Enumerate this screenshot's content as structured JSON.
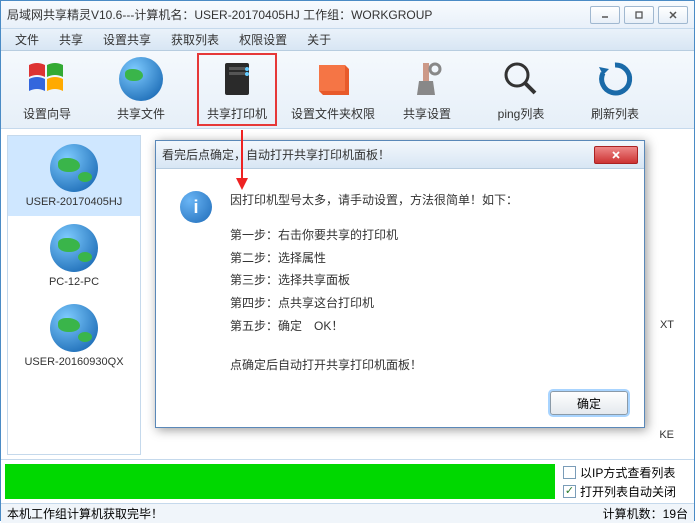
{
  "title": "局域网共享精灵V10.6---计算机名：USER-20170405HJ   工作组：WORKGROUP",
  "menu": [
    "文件",
    "共享",
    "设置共享",
    "获取列表",
    "权限设置",
    "关于"
  ],
  "toolbar": [
    {
      "label": "设置向导"
    },
    {
      "label": "共享文件"
    },
    {
      "label": "共享打印机",
      "highlight": true
    },
    {
      "label": "设置文件夹权限"
    },
    {
      "label": "共享设置"
    },
    {
      "label": "ping列表"
    },
    {
      "label": "刷新列表"
    }
  ],
  "computers": [
    {
      "name": "USER-20170405HJ",
      "selected": true
    },
    {
      "name": "PC-12-PC"
    },
    {
      "name": "USER-20160930QX"
    }
  ],
  "right_snippets": [
    "XT",
    "KE"
  ],
  "checkboxes": {
    "ip_view": {
      "label": "以IP方式查看列表",
      "checked": false
    },
    "auto_close": {
      "label": "打开列表自动关闭",
      "checked": true
    }
  },
  "status": {
    "left": "本机工作组计算机获取完毕！",
    "right": "计算机数：19台"
  },
  "dialog": {
    "title": "看完后点确定，自动打开共享打印机面板！",
    "heading": "因打印机型号太多，请手动设置，方法很简单！如下：",
    "steps": [
      "第一步：右击你要共享的打印机",
      "第二步：选择属性",
      "第三步：选择共享面板",
      "第四步：点共享这台打印机",
      "第五步：确定　OK！"
    ],
    "footer": "点确定后自动打开共享打印机面板！",
    "ok": "确定"
  }
}
